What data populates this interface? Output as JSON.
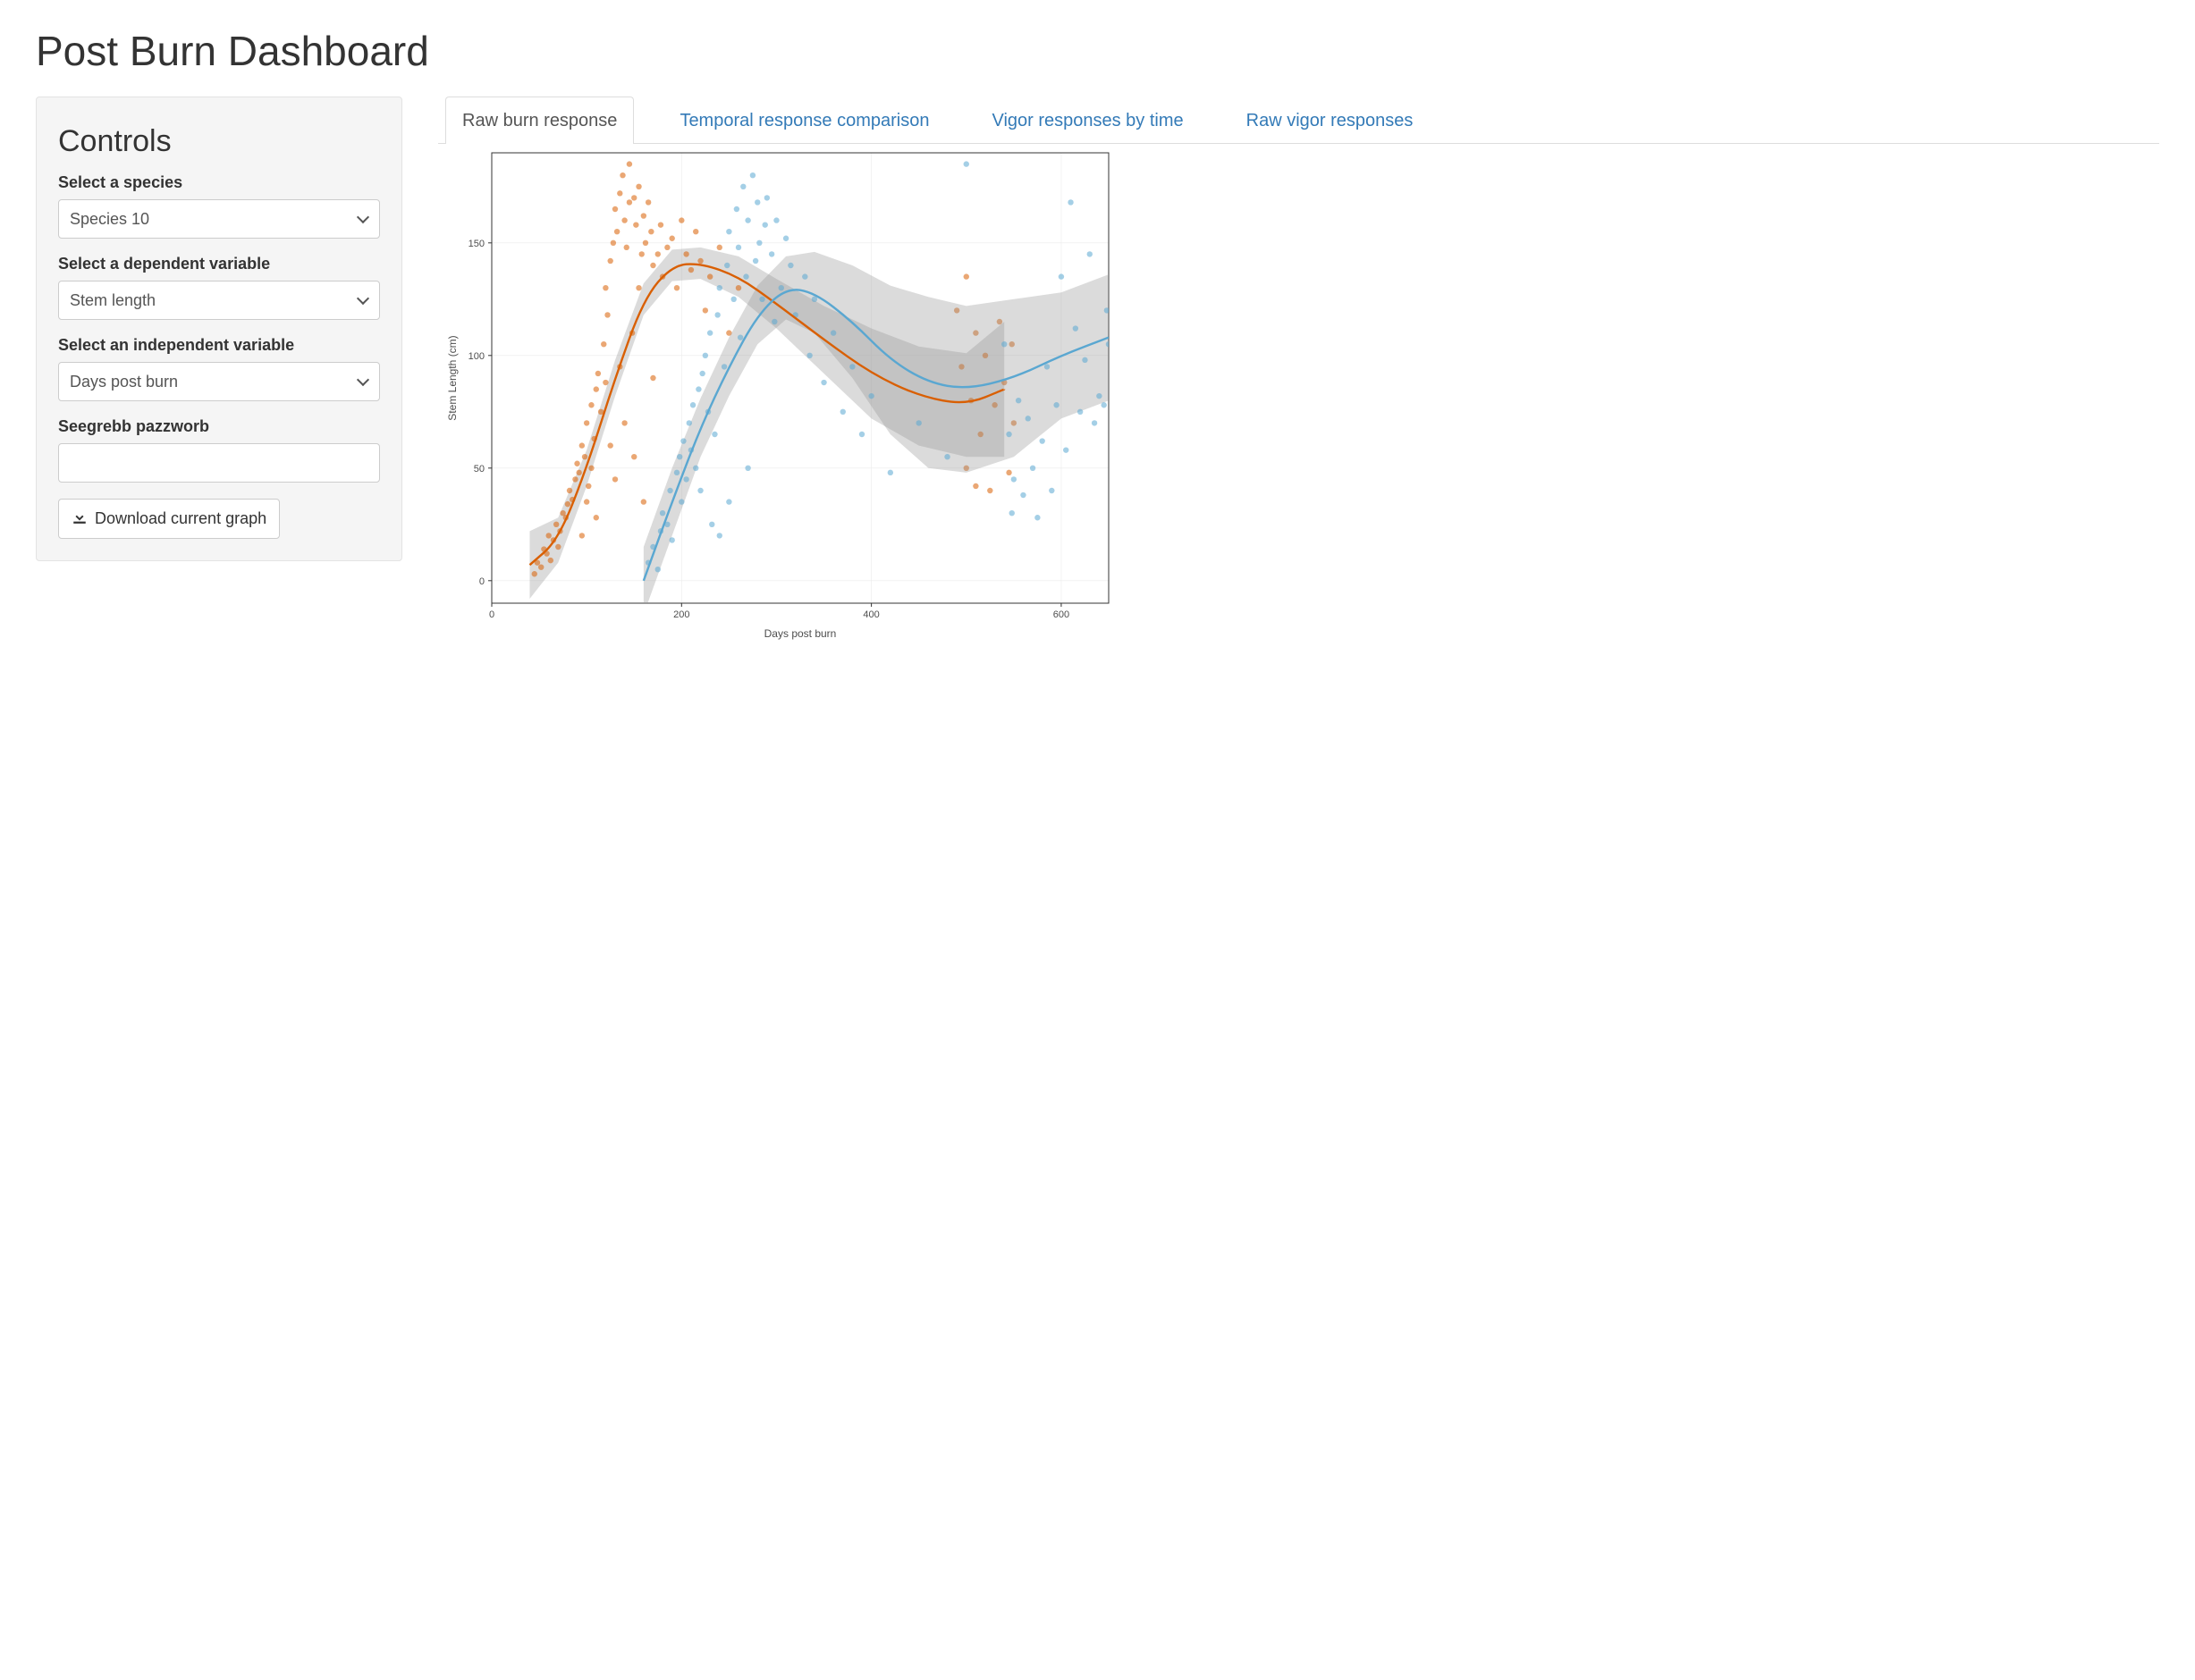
{
  "page": {
    "title": "Post Burn Dashboard"
  },
  "sidebar": {
    "heading": "Controls",
    "species_label": "Select a species",
    "species_value": "Species 10",
    "depvar_label": "Select a dependent variable",
    "depvar_value": "Stem length",
    "indvar_label": "Select an independent variable",
    "indvar_value": "Days post burn",
    "password_label": "Seegrebb pazzworb",
    "password_value": "",
    "download_label": "Download current graph"
  },
  "tabs": {
    "items": [
      {
        "label": "Raw burn response",
        "active": true
      },
      {
        "label": "Temporal response comparison",
        "active": false
      },
      {
        "label": "Vigor responses by time",
        "active": false
      },
      {
        "label": "Raw vigor responses",
        "active": false
      }
    ]
  },
  "chart_data": {
    "type": "scatter",
    "xlabel": "Days post burn",
    "ylabel": "Stem Length (cm)",
    "xlim": [
      0,
      650
    ],
    "ylim": [
      -10,
      190
    ],
    "x_ticks": [
      0,
      200,
      400,
      600
    ],
    "y_ticks": [
      0,
      50,
      100,
      150
    ],
    "colors": {
      "orange": "#d95f02",
      "blue": "#5aa7d1",
      "ribbon": "#999999"
    },
    "series": [
      {
        "name": "group-orange",
        "color": "orange",
        "smooth": {
          "x": [
            40,
            70,
            100,
            130,
            160,
            190,
            220,
            260,
            300,
            350,
            400,
            450,
            500,
            540
          ],
          "y": [
            7,
            18,
            50,
            90,
            125,
            140,
            141,
            135,
            123,
            107,
            92,
            82,
            78,
            85
          ]
        },
        "ribbon": {
          "x": [
            40,
            70,
            100,
            130,
            160,
            190,
            220,
            260,
            300,
            350,
            400,
            450,
            500,
            540
          ],
          "lo": [
            -8,
            8,
            42,
            82,
            118,
            133,
            134,
            126,
            112,
            92,
            72,
            60,
            55,
            55
          ],
          "hi": [
            22,
            28,
            58,
            98,
            132,
            147,
            148,
            144,
            134,
            122,
            112,
            104,
            101,
            115
          ]
        },
        "points": [
          [
            45,
            3
          ],
          [
            48,
            8
          ],
          [
            52,
            6
          ],
          [
            55,
            14
          ],
          [
            58,
            12
          ],
          [
            60,
            20
          ],
          [
            62,
            9
          ],
          [
            65,
            18
          ],
          [
            68,
            25
          ],
          [
            70,
            15
          ],
          [
            72,
            22
          ],
          [
            75,
            30
          ],
          [
            78,
            28
          ],
          [
            80,
            34
          ],
          [
            82,
            40
          ],
          [
            85,
            36
          ],
          [
            88,
            45
          ],
          [
            90,
            52
          ],
          [
            92,
            48
          ],
          [
            95,
            60
          ],
          [
            95,
            20
          ],
          [
            98,
            55
          ],
          [
            100,
            70
          ],
          [
            100,
            35
          ],
          [
            102,
            42
          ],
          [
            105,
            78
          ],
          [
            105,
            50
          ],
          [
            108,
            63
          ],
          [
            110,
            85
          ],
          [
            110,
            28
          ],
          [
            112,
            92
          ],
          [
            115,
            75
          ],
          [
            118,
            105
          ],
          [
            120,
            88
          ],
          [
            120,
            130
          ],
          [
            122,
            118
          ],
          [
            125,
            142
          ],
          [
            125,
            60
          ],
          [
            128,
            150
          ],
          [
            130,
            165
          ],
          [
            130,
            45
          ],
          [
            132,
            155
          ],
          [
            135,
            172
          ],
          [
            135,
            95
          ],
          [
            138,
            180
          ],
          [
            140,
            160
          ],
          [
            140,
            70
          ],
          [
            142,
            148
          ],
          [
            145,
            168
          ],
          [
            145,
            185
          ],
          [
            148,
            110
          ],
          [
            150,
            170
          ],
          [
            150,
            55
          ],
          [
            152,
            158
          ],
          [
            155,
            175
          ],
          [
            155,
            130
          ],
          [
            158,
            145
          ],
          [
            160,
            162
          ],
          [
            160,
            35
          ],
          [
            162,
            150
          ],
          [
            165,
            168
          ],
          [
            168,
            155
          ],
          [
            170,
            140
          ],
          [
            170,
            90
          ],
          [
            175,
            145
          ],
          [
            178,
            158
          ],
          [
            180,
            135
          ],
          [
            185,
            148
          ],
          [
            190,
            152
          ],
          [
            195,
            130
          ],
          [
            200,
            160
          ],
          [
            205,
            145
          ],
          [
            210,
            138
          ],
          [
            215,
            155
          ],
          [
            220,
            142
          ],
          [
            225,
            120
          ],
          [
            230,
            135
          ],
          [
            240,
            148
          ],
          [
            250,
            110
          ],
          [
            260,
            130
          ],
          [
            490,
            120
          ],
          [
            495,
            95
          ],
          [
            500,
            135
          ],
          [
            500,
            50
          ],
          [
            505,
            80
          ],
          [
            510,
            110
          ],
          [
            510,
            42
          ],
          [
            515,
            65
          ],
          [
            520,
            100
          ],
          [
            525,
            40
          ],
          [
            530,
            78
          ],
          [
            535,
            115
          ],
          [
            540,
            88
          ],
          [
            545,
            48
          ],
          [
            548,
            105
          ],
          [
            550,
            70
          ]
        ]
      },
      {
        "name": "group-blue",
        "color": "blue",
        "smooth": {
          "x": [
            160,
            190,
            220,
            250,
            280,
            310,
            340,
            380,
            420,
            460,
            500,
            550,
            600,
            650
          ],
          "y": [
            0,
            35,
            68,
            95,
            118,
            130,
            128,
            115,
            98,
            88,
            85,
            90,
            100,
            108
          ]
        },
        "ribbon": {
          "x": [
            160,
            190,
            220,
            250,
            280,
            310,
            340,
            380,
            420,
            460,
            500,
            550,
            600,
            650
          ],
          "lo": [
            -15,
            20,
            55,
            82,
            105,
            116,
            110,
            90,
            65,
            50,
            48,
            55,
            72,
            80
          ],
          "hi": [
            15,
            50,
            81,
            108,
            131,
            144,
            146,
            140,
            131,
            126,
            122,
            125,
            128,
            136
          ]
        },
        "points": [
          [
            165,
            8
          ],
          [
            170,
            15
          ],
          [
            175,
            5
          ],
          [
            178,
            22
          ],
          [
            180,
            30
          ],
          [
            185,
            25
          ],
          [
            188,
            40
          ],
          [
            190,
            18
          ],
          [
            195,
            48
          ],
          [
            198,
            55
          ],
          [
            200,
            35
          ],
          [
            202,
            62
          ],
          [
            205,
            45
          ],
          [
            208,
            70
          ],
          [
            210,
            58
          ],
          [
            212,
            78
          ],
          [
            215,
            50
          ],
          [
            218,
            85
          ],
          [
            220,
            40
          ],
          [
            222,
            92
          ],
          [
            225,
            100
          ],
          [
            228,
            75
          ],
          [
            230,
            110
          ],
          [
            232,
            25
          ],
          [
            235,
            65
          ],
          [
            238,
            118
          ],
          [
            240,
            130
          ],
          [
            240,
            20
          ],
          [
            245,
            95
          ],
          [
            248,
            140
          ],
          [
            250,
            155
          ],
          [
            250,
            35
          ],
          [
            255,
            125
          ],
          [
            258,
            165
          ],
          [
            260,
            148
          ],
          [
            262,
            108
          ],
          [
            265,
            175
          ],
          [
            268,
            135
          ],
          [
            270,
            160
          ],
          [
            270,
            50
          ],
          [
            275,
            180
          ],
          [
            278,
            142
          ],
          [
            280,
            168
          ],
          [
            282,
            150
          ],
          [
            285,
            125
          ],
          [
            288,
            158
          ],
          [
            290,
            170
          ],
          [
            295,
            145
          ],
          [
            298,
            115
          ],
          [
            300,
            160
          ],
          [
            305,
            130
          ],
          [
            310,
            152
          ],
          [
            315,
            140
          ],
          [
            320,
            118
          ],
          [
            330,
            135
          ],
          [
            335,
            100
          ],
          [
            340,
            125
          ],
          [
            350,
            88
          ],
          [
            360,
            110
          ],
          [
            370,
            75
          ],
          [
            380,
            95
          ],
          [
            390,
            65
          ],
          [
            400,
            82
          ],
          [
            420,
            48
          ],
          [
            450,
            70
          ],
          [
            480,
            55
          ],
          [
            500,
            185
          ],
          [
            540,
            105
          ],
          [
            545,
            65
          ],
          [
            548,
            30
          ],
          [
            550,
            45
          ],
          [
            555,
            80
          ],
          [
            560,
            38
          ],
          [
            565,
            72
          ],
          [
            570,
            50
          ],
          [
            575,
            28
          ],
          [
            580,
            62
          ],
          [
            585,
            95
          ],
          [
            590,
            40
          ],
          [
            595,
            78
          ],
          [
            600,
            135
          ],
          [
            605,
            58
          ],
          [
            610,
            168
          ],
          [
            615,
            112
          ],
          [
            620,
            75
          ],
          [
            625,
            98
          ],
          [
            630,
            145
          ],
          [
            635,
            70
          ],
          [
            640,
            82
          ],
          [
            645,
            78
          ],
          [
            648,
            120
          ],
          [
            650,
            105
          ]
        ]
      }
    ]
  }
}
